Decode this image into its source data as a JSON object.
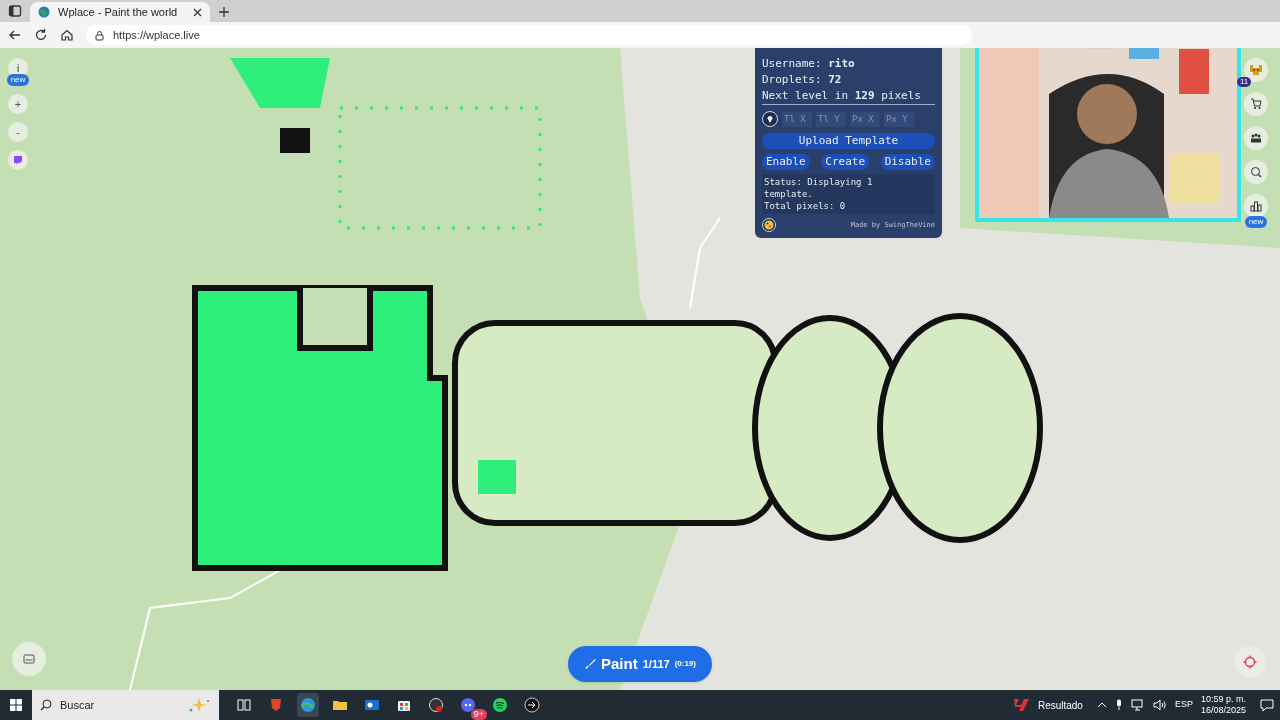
{
  "browser": {
    "tab_title": "Wplace - Paint the world",
    "url": "https://wplace.live"
  },
  "left_controls": {
    "info": "i",
    "info_badge": "new",
    "zoom_in": "+",
    "zoom_out": "-"
  },
  "overlay_panel": {
    "lines": [
      "Username: **rito**",
      "Droplets: **72**",
      "Next level in **129** pixels"
    ],
    "coord_fields": [
      {
        "placeholder": "Tl X"
      },
      {
        "placeholder": "Tl Y"
      },
      {
        "placeholder": "Px X"
      },
      {
        "placeholder": "Px Y"
      }
    ],
    "upload_button": "Upload Template",
    "buttons": [
      "Enable",
      "Create",
      "Disable"
    ],
    "status_lines": [
      "Status: Displaying 1",
      "template.",
      "Total pixels: 0"
    ],
    "credit": "Made by SwingTheVine"
  },
  "right_toolbar": {
    "notification_count": "11",
    "leaderboard_badge": "new"
  },
  "paint_button": {
    "label": "Paint",
    "count": "1/117",
    "timer": "(0:19)"
  },
  "taskbar": {
    "search_placeholder": "Buscar",
    "discord_badge": "9+",
    "widget": "Resultado",
    "language": "ESP",
    "time": "10:59 p. m.",
    "date": "16/08/2025"
  }
}
